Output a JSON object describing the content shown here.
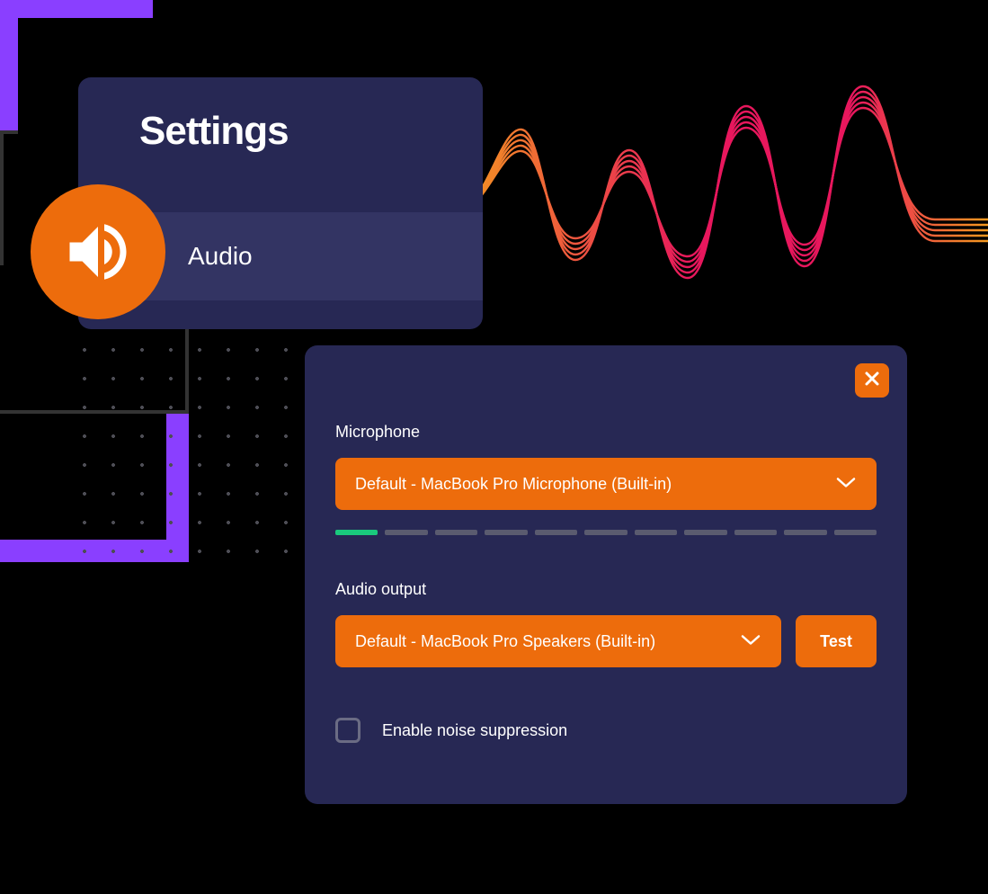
{
  "colors": {
    "accent": "#ed6c0c",
    "panel_bg": "#272854",
    "purple": "#8a3fff",
    "meter_active": "#1ac97d"
  },
  "settings_card": {
    "title": "Settings",
    "active_section": "Audio"
  },
  "panel": {
    "microphone": {
      "label": "Microphone",
      "selected": "Default - MacBook Pro Microphone (Built-in)"
    },
    "level_meter": {
      "segments": 11,
      "active_segments": 1
    },
    "output": {
      "label": "Audio output",
      "selected": "Default - MacBook Pro Speakers (Built-in)",
      "test_button": "Test"
    },
    "noise_suppression": {
      "label": "Enable noise suppression",
      "checked": false
    }
  }
}
